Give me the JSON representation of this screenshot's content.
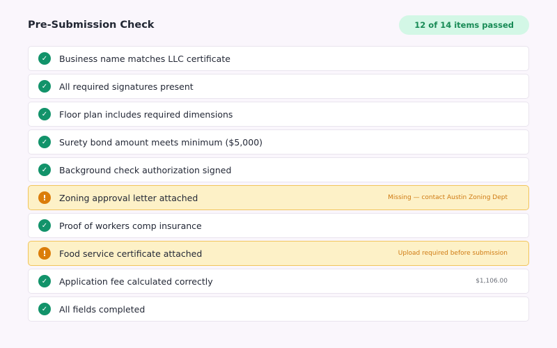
{
  "header": {
    "title": "Pre-Submission Check",
    "summary": "12 of 14 items passed"
  },
  "checks": [
    {
      "status": "pass",
      "icon": "check-icon",
      "label": "Business name matches LLC certificate",
      "note": ""
    },
    {
      "status": "pass",
      "icon": "check-icon",
      "label": "All required signatures present",
      "note": ""
    },
    {
      "status": "pass",
      "icon": "check-icon",
      "label": "Floor plan includes required dimensions",
      "note": ""
    },
    {
      "status": "pass",
      "icon": "check-icon",
      "label": "Surety bond amount meets minimum ($5,000)",
      "note": ""
    },
    {
      "status": "pass",
      "icon": "check-icon",
      "label": "Background check authorization signed",
      "note": ""
    },
    {
      "status": "warn",
      "icon": "warning-icon",
      "label": "Zoning approval letter attached",
      "note": "Missing — contact Austin Zoning Dept"
    },
    {
      "status": "pass",
      "icon": "check-icon",
      "label": "Proof of workers comp insurance",
      "note": ""
    },
    {
      "status": "warn",
      "icon": "warning-icon",
      "label": "Food service certificate attached",
      "note": "Upload required before submission"
    },
    {
      "status": "pass",
      "icon": "check-icon",
      "label": "Application fee calculated correctly",
      "note": "$1,106.00"
    },
    {
      "status": "pass",
      "icon": "check-icon",
      "label": "All fields completed",
      "note": ""
    }
  ],
  "colors": {
    "pass": "#12936a",
    "warn": "#db7d0a",
    "warn_background": "#fdf1c7",
    "summary_background": "#d3f7e6",
    "summary_text": "#178a55"
  }
}
